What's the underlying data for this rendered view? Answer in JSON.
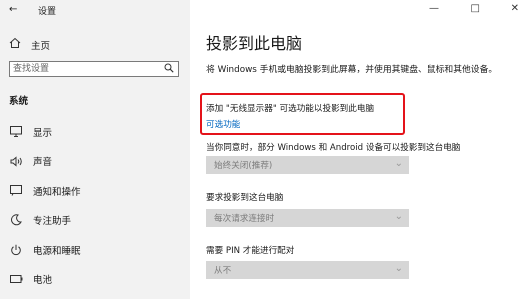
{
  "window": {
    "title": "设置",
    "back_icon": "←",
    "minimize_icon": "—",
    "maximize_icon": "□",
    "close_icon": "✕"
  },
  "sidebar": {
    "home_label": "主页",
    "search_placeholder": "查找设置",
    "section": "系统",
    "items": [
      {
        "label": "显示",
        "icon": "display-icon"
      },
      {
        "label": "声音",
        "icon": "speaker-icon"
      },
      {
        "label": "通知和操作",
        "icon": "notification-icon"
      },
      {
        "label": "专注助手",
        "icon": "moon-icon"
      },
      {
        "label": "电源和睡眠",
        "icon": "power-icon"
      },
      {
        "label": "电池",
        "icon": "battery-icon"
      }
    ]
  },
  "main": {
    "title": "投影到此电脑",
    "description": "将 Windows 手机或电脑投影到此屏幕，并使用其键盘、鼠标和其他设备。",
    "add_text": "添加 \"无线显示器\" 可选功能以投影到此电脑",
    "optional_link": "可选功能",
    "setting1": {
      "label": "当你同意时，部分 Windows 和 Android 设备可以投影到这台电脑",
      "value": "始终关闭(推荐)"
    },
    "setting2": {
      "label": "要求投影到这台电脑",
      "value": "每次请求连接时"
    },
    "setting3": {
      "label": "需要 PIN 才能进行配对",
      "value": "从不"
    }
  },
  "colors": {
    "sidebar_bg": "#f2f2f2",
    "highlight_border": "#e4131a",
    "link": "#0067c0",
    "dropdown_disabled_bg": "#d6d6d6"
  }
}
